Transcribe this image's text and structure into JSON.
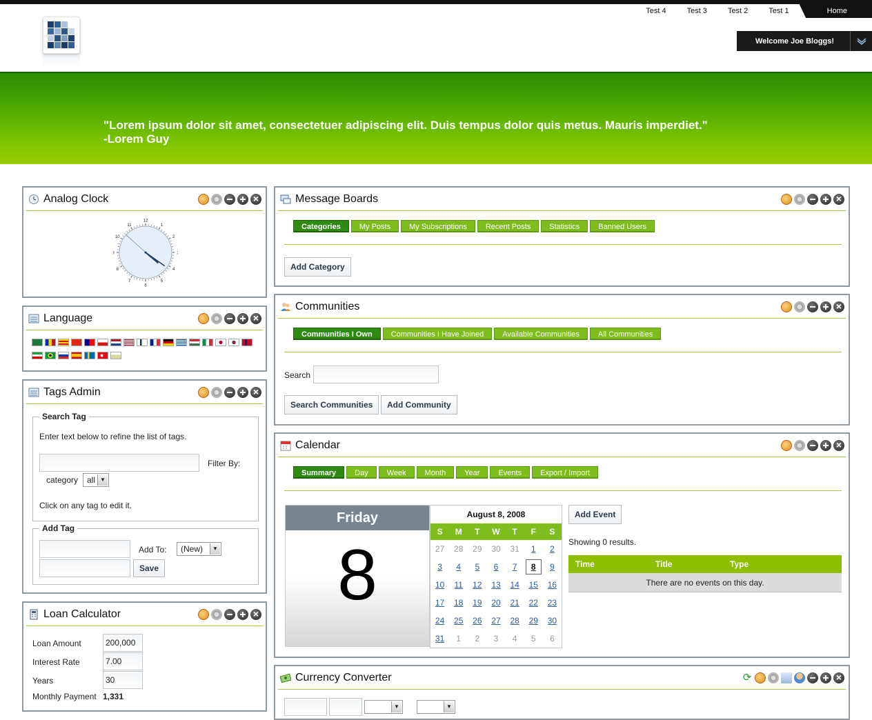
{
  "header": {
    "nav": [
      "Test 4",
      "Test 3",
      "Test 2",
      "Test 1"
    ],
    "home_label": "Home",
    "welcome": "Welcome Joe Bloggs!",
    "quote_line1": "\"Lorem ipsum dolor sit amet, consectetuer adipiscing elit. Duis tempus dolor quis metus. Mauris imperdiet.\"",
    "quote_line2": "-Lorem Guy"
  },
  "analog_clock": {
    "title": "Analog Clock",
    "time": {
      "hour": 4,
      "minute": 20,
      "second": 52
    }
  },
  "language": {
    "title": "Language"
  },
  "tags_admin": {
    "title": "Tags Admin",
    "search_legend": "Search Tag",
    "search_hint": "Enter text below to refine the list of tags.",
    "filter_by": "Filter By:",
    "category_label": "category",
    "category_value": "all",
    "click_hint": "Click on any tag to edit it.",
    "add_legend": "Add Tag",
    "add_to_label": "Add To:",
    "add_to_value": "(New)",
    "save_label": "Save"
  },
  "loan_calculator": {
    "title": "Loan Calculator",
    "loan_amount_label": "Loan Amount",
    "loan_amount": "200,000",
    "interest_rate_label": "Interest Rate",
    "interest_rate": "7.00",
    "years_label": "Years",
    "years": "30",
    "monthly_payment_label": "Monthly Payment",
    "monthly_payment": "1,331"
  },
  "message_boards": {
    "title": "Message Boards",
    "tabs": [
      "Categories",
      "My Posts",
      "My Subscriptions",
      "Recent Posts",
      "Statistics",
      "Banned Users"
    ],
    "add_category": "Add Category"
  },
  "communities": {
    "title": "Communities",
    "tabs": [
      "Communities I Own",
      "Communities I Have Joined",
      "Available Communities",
      "All Communities"
    ],
    "search_label": "Search",
    "search_button": "Search Communities",
    "add_button": "Add Community"
  },
  "calendar": {
    "title": "Calendar",
    "tabs": [
      "Summary",
      "Day",
      "Week",
      "Month",
      "Year",
      "Events",
      "Export / Import"
    ],
    "day_name": "Friday",
    "day_number": "8",
    "month_header": "August 8, 2008",
    "weekdays": [
      "S",
      "M",
      "T",
      "W",
      "T",
      "F",
      "S"
    ],
    "add_event": "Add Event",
    "showing": "Showing 0 results.",
    "columns": [
      "Time",
      "Title",
      "Type"
    ],
    "empty_message": "There are no events on this day."
  },
  "currency_converter": {
    "title": "Currency Converter"
  }
}
